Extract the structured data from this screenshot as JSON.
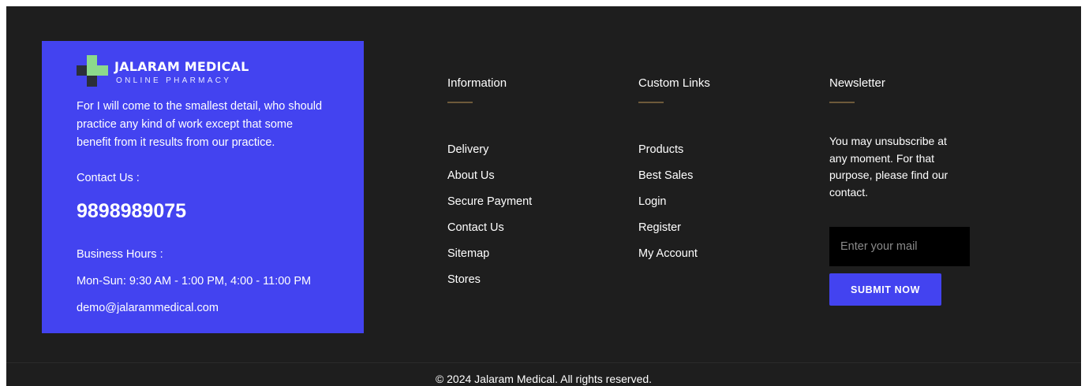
{
  "brand": {
    "title": "JALARAM MEDICAL",
    "subtitle": "ONLINE PHARMACY",
    "about": "For I will come to the smallest detail, who should practice any kind of work except that some benefit from it results from our practice.",
    "contact_label": "Contact Us :",
    "phone": "9898989075",
    "hours_label": "Business Hours :",
    "hours": "Mon-Sun: 9:30 AM - 1:00 PM, 4:00 - 11:00 PM",
    "email": "demo@jalarammedical.com",
    "colors": {
      "box": "#4343f0",
      "logo_green": "#8cd98c",
      "logo_dark": "#2b2f3a"
    }
  },
  "information": {
    "title": "Information",
    "links": [
      "Delivery",
      "About Us",
      "Secure Payment",
      "Contact Us",
      "Sitemap",
      "Stores"
    ]
  },
  "custom_links": {
    "title": "Custom Links",
    "links": [
      "Products",
      "Best Sales",
      "Login",
      "Register",
      "My Account"
    ]
  },
  "newsletter": {
    "title": "Newsletter",
    "text": "You may unsubscribe at any moment. For that purpose, please find our contact.",
    "input_placeholder": "Enter your mail",
    "submit_label": "SUBMIT NOW"
  },
  "copyright": "© 2024 Jalaram Medical. All rights reserved.",
  "colors": {
    "footer_bg": "#1e1e1e",
    "accent": "#4343f0",
    "heading_rule": "#6e5a3a"
  }
}
